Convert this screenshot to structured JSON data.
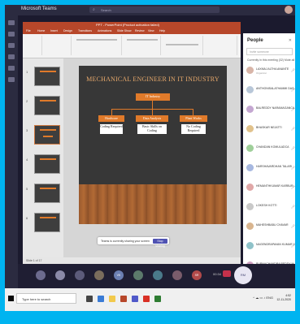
{
  "teams": {
    "title": "Microsoft Teams",
    "search_placeholder": "Search"
  },
  "ppt": {
    "title": "PPT - PowerPoint (Product activation failed)",
    "tabs": [
      "File",
      "Home",
      "Insert",
      "Design",
      "Transitions",
      "Animations",
      "Slide Show",
      "Review",
      "View",
      "Help"
    ],
    "status": "Slide 1 of 17"
  },
  "slide": {
    "title": "MECHANICAL ENGINEER IN IT INDUSTRY",
    "root": "IT Industry",
    "branches": [
      "Hardware",
      "Data Analysis",
      "Plant Works"
    ],
    "leaves": [
      "Coding Required",
      "Basic Skills on Coding",
      "No Coding Required"
    ]
  },
  "share_banner": {
    "text": "Teams is currently sharing your screen",
    "stop_label": "Stop sharing"
  },
  "people": {
    "title": "People",
    "invite_placeholder": "Invite someone",
    "in_meeting_label": "Currently in this meeting (32)",
    "mute_all": "Mute all",
    "list": [
      {
        "name": "LAXMAJ ALTHA ANANTE",
        "sub": "Organizer",
        "color": "#d8b5a8"
      },
      {
        "name": "ANTHONISALATHAMMI DAS...",
        "sub": "",
        "color": "#b8c7d8"
      },
      {
        "name": "BALREDDY NARAMAGANCA",
        "sub": "",
        "color": "#c4a7d1"
      },
      {
        "name": "BHASKAR NEJATTI",
        "sub": "",
        "color": "#e1c28c"
      },
      {
        "name": "CHANDAN KOMULADCA",
        "sub": "",
        "color": "#9fcf9a"
      },
      {
        "name": "HARSHAVARDHAN TALARI",
        "sub": "",
        "color": "#a7b8e0"
      },
      {
        "name": "HEMANTHKUMAR KARBUR...",
        "sub": "",
        "color": "#e0a7a7"
      },
      {
        "name": "LOKESH KOTTI",
        "sub": "",
        "color": "#c9c9c9"
      },
      {
        "name": "MAHESHBABU CHAVAR",
        "sub": "",
        "color": "#d9b58f"
      },
      {
        "name": "NAGENDRAPAVAN KUMAR Y...",
        "sub": "",
        "color": "#8fc2c9"
      },
      {
        "name": "PURNACHANDRA REDDY M...",
        "sub": "",
        "color": "#d1a1c3"
      }
    ]
  },
  "meeting": {
    "tiles": [
      "",
      "",
      "",
      "",
      "VK",
      "",
      "",
      "",
      "SR"
    ],
    "big_tile": "RM",
    "time": "00:34"
  },
  "taskbar": {
    "search_placeholder": "Type here to search",
    "clock_time": "4:52",
    "clock_date": "12-11-2020"
  }
}
